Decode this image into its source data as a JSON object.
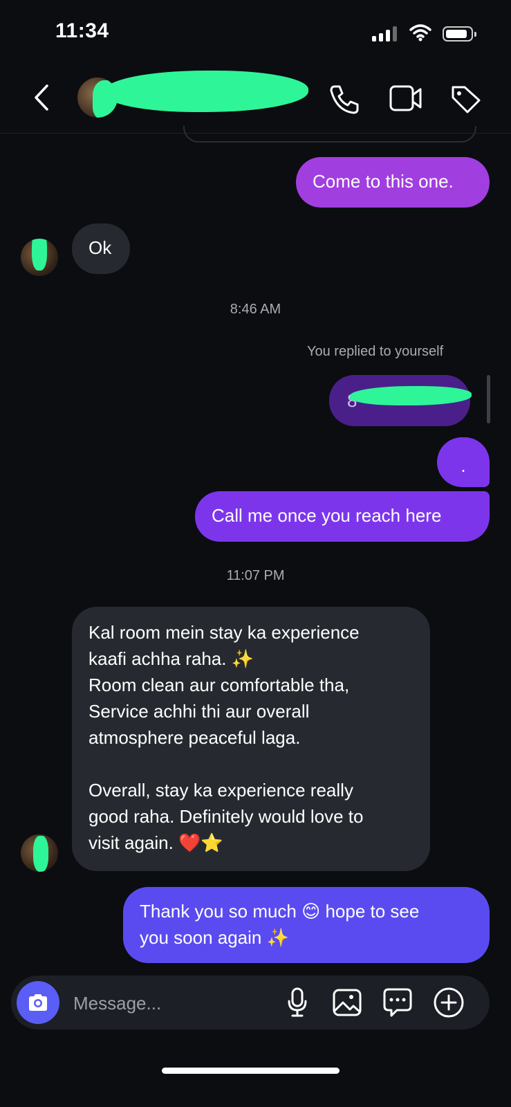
{
  "status_bar": {
    "time": "11:34"
  },
  "header": {
    "contact_name": "",
    "contact_username": ""
  },
  "messages": [
    {
      "type": "outgoing",
      "text": "Come to this one."
    },
    {
      "type": "incoming",
      "text": "Ok"
    },
    {
      "type": "timestamp",
      "text": "8:46 AM"
    },
    {
      "type": "reply_label",
      "text": "You replied to yourself"
    },
    {
      "type": "quoted",
      "text": "8"
    },
    {
      "type": "outgoing",
      "text": "."
    },
    {
      "type": "outgoing",
      "text": "Call me once you reach here"
    },
    {
      "type": "timestamp",
      "text": "11:07 PM"
    },
    {
      "type": "incoming",
      "lines": [
        "Kal room mein stay ka experience",
        "kaafi achha raha. ✨",
        "Room clean aur comfortable tha,",
        "Service achhi thi aur overall",
        "atmosphere peaceful laga.",
        "",
        "Overall, stay ka experience really",
        "good raha. Definitely would love to",
        "visit again. ❤️⭐"
      ]
    },
    {
      "type": "outgoing",
      "lines": [
        "Thank you so much 😊 hope to see",
        "you soon again ✨"
      ]
    }
  ],
  "composer": {
    "placeholder": "Message..."
  },
  "icons": {
    "back": "chevron-left-icon",
    "call": "phone-icon",
    "video": "video-camera-icon",
    "tag": "tag-icon",
    "camera": "camera-icon",
    "mic": "microphone-icon",
    "gallery": "image-icon",
    "sticker": "chat-bubble-icon",
    "add": "plus-circle-icon"
  },
  "colors": {
    "background": "#0b0d11",
    "bubble_purple": "#a13ee0",
    "bubble_violet": "#7d35ec",
    "bubble_blue": "#5a4bf0",
    "bubble_incoming": "#262a30",
    "camera_button": "#5a5ef5"
  }
}
